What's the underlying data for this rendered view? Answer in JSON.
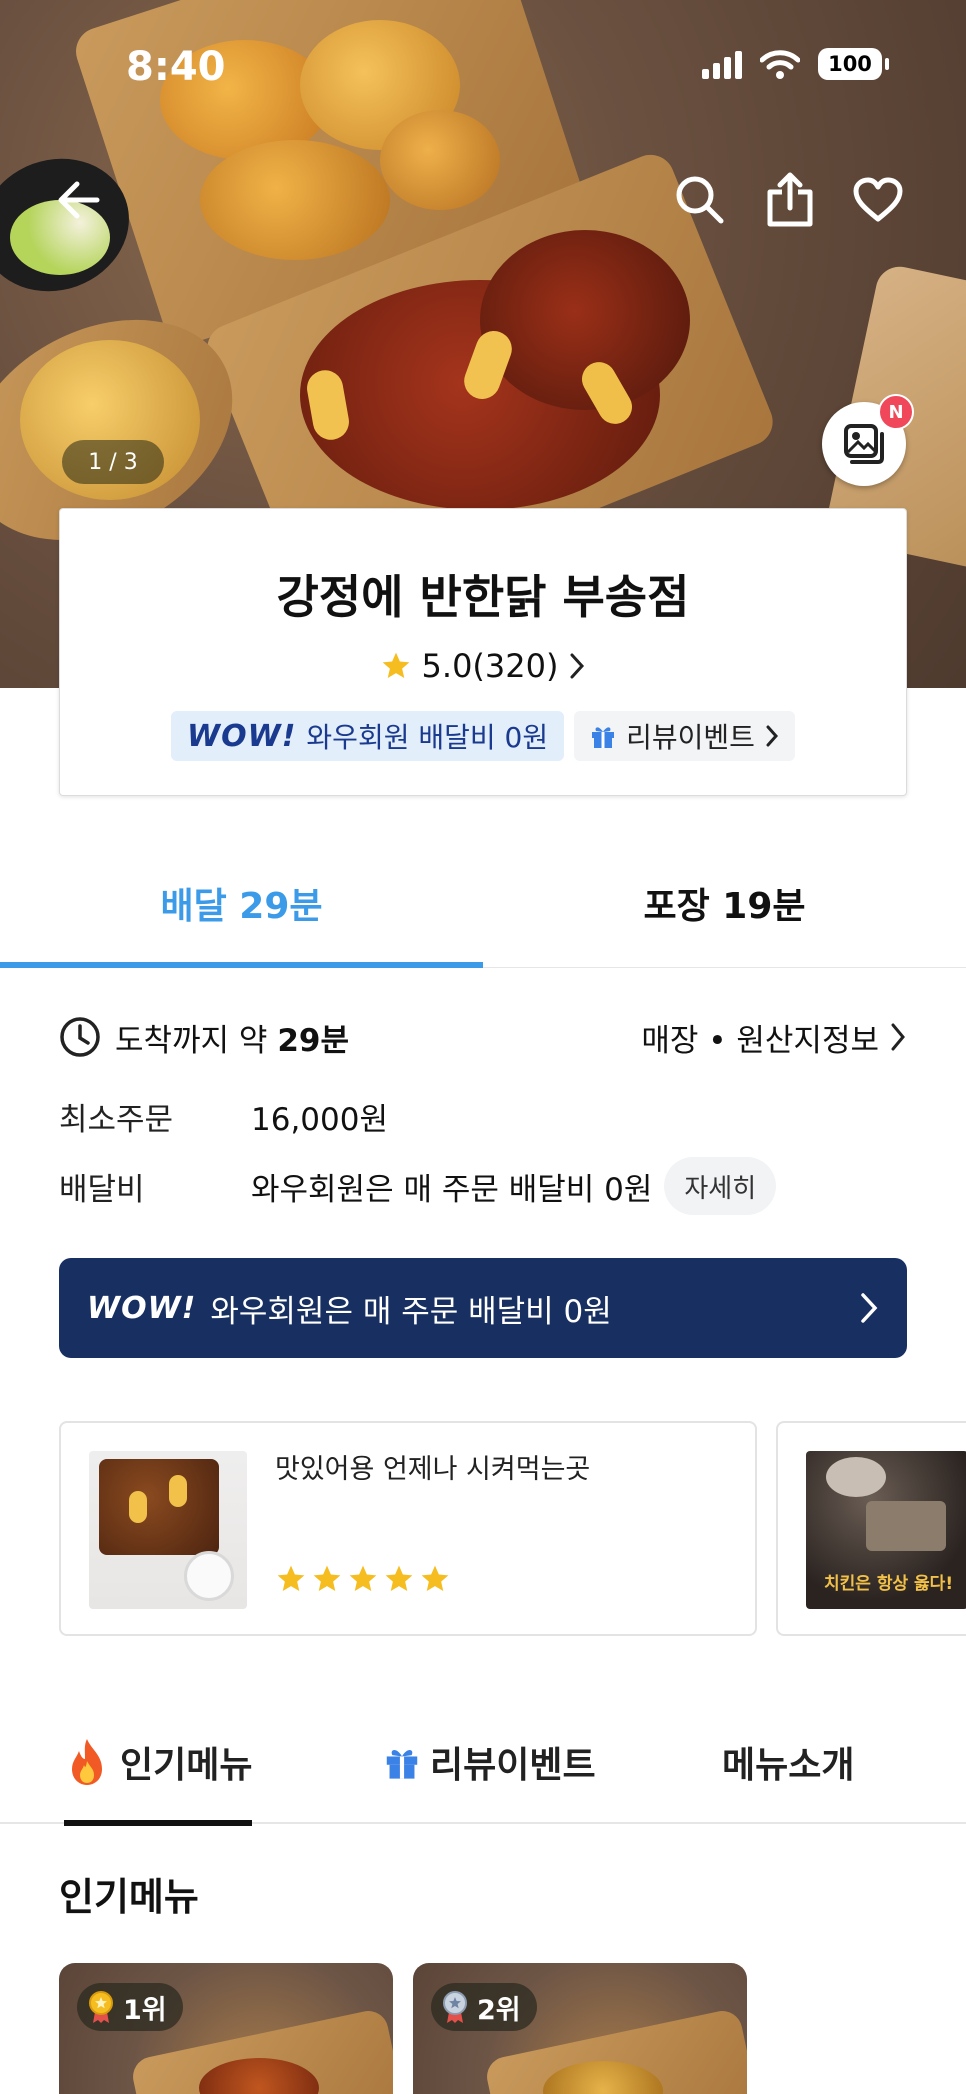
{
  "status_bar": {
    "time": "8:40",
    "battery": "100"
  },
  "hero": {
    "photo_counter": "1 / 3",
    "photo_badge": "N",
    "icons": [
      "back-arrow-icon",
      "search-icon",
      "share-icon",
      "heart-icon",
      "photo-gallery-icon"
    ]
  },
  "store": {
    "name": "강정에 반한닭 부송점",
    "rating": "5.0",
    "review_count": "(320)",
    "wow_logo": "WOW!",
    "wow_label": "와우회원 배달비 0원",
    "review_event_label": "리뷰이벤트"
  },
  "delivery_tabs": [
    {
      "label": "배달 29분",
      "active": true
    },
    {
      "label": "포장 19분",
      "active": false
    }
  ],
  "info": {
    "arrive_prefix": "도착까지 약 ",
    "arrive_time": "29분",
    "store_info_link": "매장 • 원산지정보",
    "min_order_label": "최소주문",
    "min_order_value": "16,000원",
    "delivery_fee_label": "배달비",
    "delivery_fee_value": "와우회원은 매 주문 배달비 0원",
    "detail_button": "자세히"
  },
  "wow_banner": {
    "logo": "WOW!",
    "text": "와우회원은 매 주문 배달비 0원"
  },
  "reviews": [
    {
      "text": "맛있어용 언제나 시켜먹는곳",
      "stars": 5
    },
    {
      "image_caption": "치킨은 항상 옳다!"
    }
  ],
  "section_tabs": [
    {
      "label": "인기메뉴",
      "icon": "fire-icon",
      "active": true
    },
    {
      "label": "리뷰이벤트",
      "icon": "gift-icon",
      "active": false
    },
    {
      "label": "메뉴소개",
      "icon": "",
      "active": false
    }
  ],
  "popular_menu": {
    "heading": "인기메뉴",
    "items": [
      {
        "rank": "1위",
        "medal": "gold"
      },
      {
        "rank": "2위",
        "medal": "silver"
      }
    ]
  },
  "colors": {
    "accent_blue": "#3c9be8",
    "wow_navy": "#182f61",
    "wow_pill_bg": "#e3eefb",
    "star_yellow": "#f5bd1f",
    "badge_red": "#f0485a"
  }
}
